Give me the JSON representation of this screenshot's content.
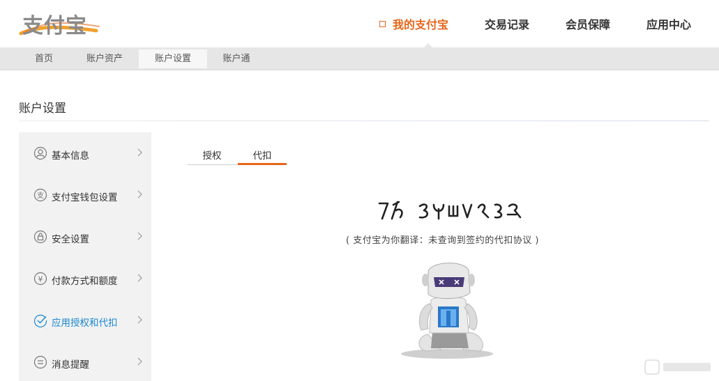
{
  "header": {
    "logo_text": "支付宝",
    "nav": [
      {
        "label": "我的支付宝",
        "active": true
      },
      {
        "label": "交易记录",
        "active": false
      },
      {
        "label": "会员保障",
        "active": false
      },
      {
        "label": "应用中心",
        "active": false
      }
    ],
    "accent_color": "#e6661a"
  },
  "subnav": [
    {
      "label": "首页",
      "active": false
    },
    {
      "label": "账户资产",
      "active": false
    },
    {
      "label": "账户设置",
      "active": true
    },
    {
      "label": "账户通",
      "active": false
    }
  ],
  "page_title": "账户设置",
  "sidebar": [
    {
      "label": "基本信息",
      "icon": "user-icon",
      "active": false
    },
    {
      "label": "支付宝钱包设置",
      "icon": "wallet-icon",
      "active": false
    },
    {
      "label": "安全设置",
      "icon": "lock-icon",
      "active": false
    },
    {
      "label": "付款方式和额度",
      "icon": "yen-icon",
      "active": false
    },
    {
      "label": "应用授权和代扣",
      "icon": "check-circle-icon",
      "active": true
    },
    {
      "label": "消息提醒",
      "icon": "message-icon",
      "active": false
    }
  ],
  "tabs": [
    {
      "label": "授权",
      "active": false
    },
    {
      "label": "代扣",
      "active": true
    }
  ],
  "empty_state": {
    "alien_title_icon": "alien-text-glyphs",
    "message": "( 支付宝为你翻译：未查询到签约的代扣协议 )",
    "illustration": "robot-illustration"
  },
  "link_color": "#1a88d0"
}
